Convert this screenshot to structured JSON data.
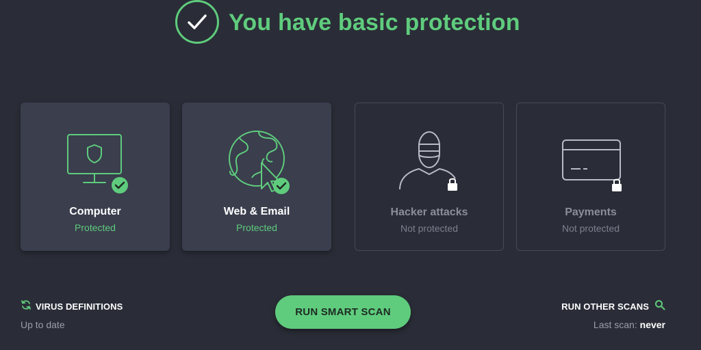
{
  "header": {
    "title": "You have basic protection",
    "status_icon": "check-circle-icon"
  },
  "cards": [
    {
      "title": "Computer",
      "status": "Protected",
      "icon": "monitor-shield-icon",
      "badge": "check-badge-icon",
      "protected": true
    },
    {
      "title": "Web & Email",
      "status": "Protected",
      "icon": "globe-cursor-icon",
      "badge": "check-badge-icon",
      "protected": true
    },
    {
      "title": "Hacker attacks",
      "status": "Not protected",
      "icon": "hacker-icon",
      "badge": "lock-icon",
      "protected": false
    },
    {
      "title": "Payments",
      "status": "Not protected",
      "icon": "credit-card-icon",
      "badge": "lock-icon",
      "protected": false
    }
  ],
  "virus_definitions": {
    "label": "VIRUS DEFINITIONS",
    "status": "Up to date",
    "icon": "refresh-icon"
  },
  "scan_button": {
    "label": "RUN SMART SCAN"
  },
  "other_scans": {
    "label": "RUN OTHER SCANS",
    "icon": "search-icon",
    "last_scan_label": "Last scan:",
    "last_scan_value": "never"
  },
  "colors": {
    "background": "#2a2d37",
    "accent_green": "#5fcc7d",
    "card_active": "#3a3e4d",
    "card_border_inactive": "#464a58"
  }
}
